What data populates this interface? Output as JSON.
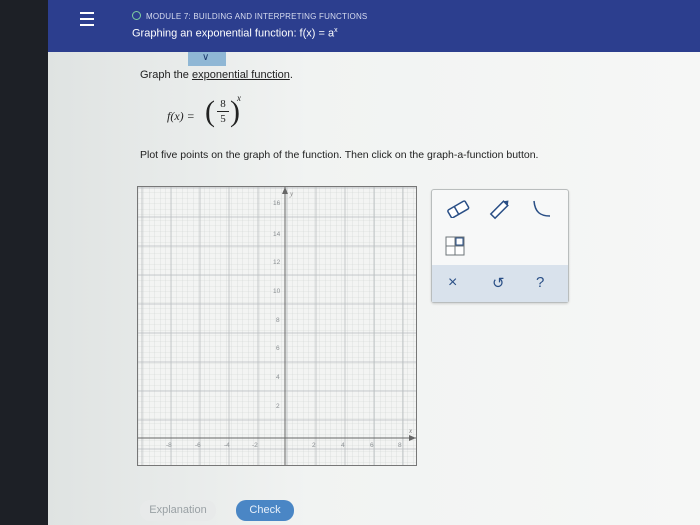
{
  "header": {
    "module": "MODULE 7: BUILDING AND INTERPRETING FUNCTIONS",
    "topic": "Graphing an exponential function: f(x) = a",
    "topic_sup": "x"
  },
  "question": {
    "prompt_prefix": "Graph the ",
    "prompt_link": "exponential function",
    "prompt_suffix": ".",
    "f_label": "f(x) =",
    "numerator": "8",
    "denominator": "5",
    "exponent": "x",
    "instruction": "Plot five points on the graph of the function. Then click on the graph-a-function button."
  },
  "graph": {
    "y_axis_label": "y",
    "y_ticks": [
      "16",
      "14",
      "12",
      "10",
      "8",
      "6",
      "4",
      "2"
    ],
    "x_ticks_neg": [
      "-8",
      "-6",
      "-4",
      "-2"
    ],
    "x_ticks_pos": [
      "2",
      "4",
      "6",
      "8"
    ],
    "x_axis_label": "x"
  },
  "tools": {
    "eraser": "eraser-icon",
    "pencil": "pencil-icon",
    "curve": "curve-icon",
    "graph_function": "graph-function-icon",
    "clear_symbol": "×",
    "undo_symbol": "↺",
    "help_symbol": "?"
  },
  "buttons": {
    "explanation": "Explanation",
    "check": "Check"
  },
  "colors": {
    "header_bg": "#2c3e8e",
    "check_button": "#4a86c5",
    "tool_bottom_row": "#d9e2ec"
  }
}
